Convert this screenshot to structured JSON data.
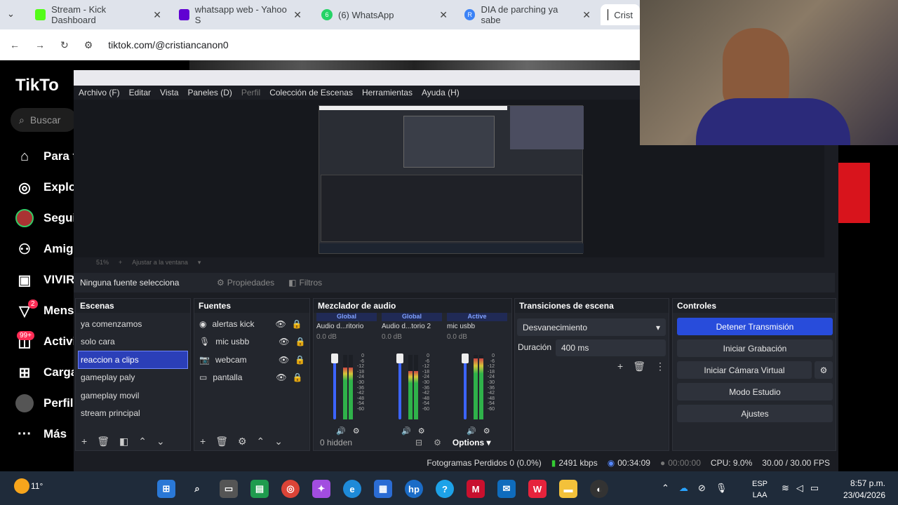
{
  "browser": {
    "tabs": [
      {
        "title": "Stream - Kick Dashboard",
        "color": "#53fc18"
      },
      {
        "title": "whatsapp web - Yahoo S",
        "color": "#6001d2"
      },
      {
        "title": "(6) WhatsApp",
        "color": "#25d366",
        "badge": "6"
      },
      {
        "title": "DIA de parching ya sabe",
        "color": "#3b82f6",
        "badge": "R"
      },
      {
        "title": "Crist",
        "color": "#000000"
      }
    ],
    "url": "tiktok.com/@cristiancanon0"
  },
  "tiktok": {
    "logo": "TikTo",
    "search_placeholder": "Buscar",
    "nav": [
      {
        "label": "Para t",
        "icon": "home-icon"
      },
      {
        "label": "Explo",
        "icon": "compass-icon"
      },
      {
        "label": "Segui",
        "icon": "avatar-icon"
      },
      {
        "label": "Amigo",
        "icon": "friends-icon"
      },
      {
        "label": "VIVIR",
        "icon": "live-icon"
      },
      {
        "label": "Mens",
        "icon": "messages-icon",
        "badge": "2"
      },
      {
        "label": "Activi",
        "icon": "activity-icon",
        "badge": "99+"
      },
      {
        "label": "Carga",
        "icon": "upload-icon"
      },
      {
        "label": "Perfil",
        "icon": "profile-icon"
      },
      {
        "label": "Más",
        "icon": "more-icon"
      }
    ]
  },
  "obs": {
    "menu": [
      "Archivo (F)",
      "Editar",
      "Vista",
      "Paneles (D)",
      "Perfil",
      "Colección de Escenas",
      "Herramientas",
      "Ayuda (H)"
    ],
    "zoom": "51%",
    "zoom_fit": "Ajustar a la ventana",
    "source_bar": {
      "status": "Ninguna fuente selecciona",
      "properties": "Propiedades",
      "filters": "Filtros"
    },
    "scenes": {
      "title": "Escenas",
      "items": [
        "ya comenzamos",
        "solo cara",
        "reaccion a clips",
        "gameplay paly",
        "gameplay movil",
        "stream principal"
      ],
      "selected": "reaccion a clips"
    },
    "sources": {
      "title": "Fuentes",
      "items": [
        {
          "label": "alertas kick",
          "icon": "browser-icon"
        },
        {
          "label": "mic usbb",
          "icon": "mic-icon"
        },
        {
          "label": "webcam",
          "icon": "camera-icon"
        },
        {
          "label": "pantalla",
          "icon": "display-icon"
        }
      ]
    },
    "mixer": {
      "title": "Mezclador de audio",
      "channels": [
        {
          "group": "Global",
          "name": "Audio d...ritorio",
          "db": "0.0 dB",
          "level": 0.8
        },
        {
          "group": "Global",
          "name": "Audio d...torio 2",
          "db": "0.0 dB",
          "level": 0.75
        },
        {
          "group": "Active",
          "name": "mic usbb",
          "db": "0.0 dB",
          "level": 0.95
        }
      ],
      "scale": [
        "0",
        "-6",
        "-12",
        "-18",
        "-24",
        "-30",
        "-36",
        "-42",
        "-48",
        "-54",
        "-60"
      ],
      "hidden": "0 hidden",
      "options": "Options"
    },
    "transitions": {
      "title": "Transiciones de escena",
      "type": "Desvanecimiento",
      "duration_label": "Duración",
      "duration": "400 ms"
    },
    "controls": {
      "title": "Controles",
      "buttons": [
        "Detener Transmisión",
        "Iniciar Grabación",
        "Iniciar Cámara Virtual",
        "Modo Estudio",
        "Ajustes"
      ]
    },
    "status": {
      "dropped": "Fotogramas Perdidos 0 (0.0%)",
      "bitrate": "2491 kbps",
      "live_time": "00:34:09",
      "rec_time": "00:00:00",
      "cpu": "CPU: 9.0%",
      "fps": "30.00 / 30.00 FPS"
    }
  },
  "taskbar": {
    "weather": "11°",
    "lang": "ESP",
    "layout": "LAA",
    "time": "8:57 p.m.",
    "date": "23/04/2026"
  }
}
